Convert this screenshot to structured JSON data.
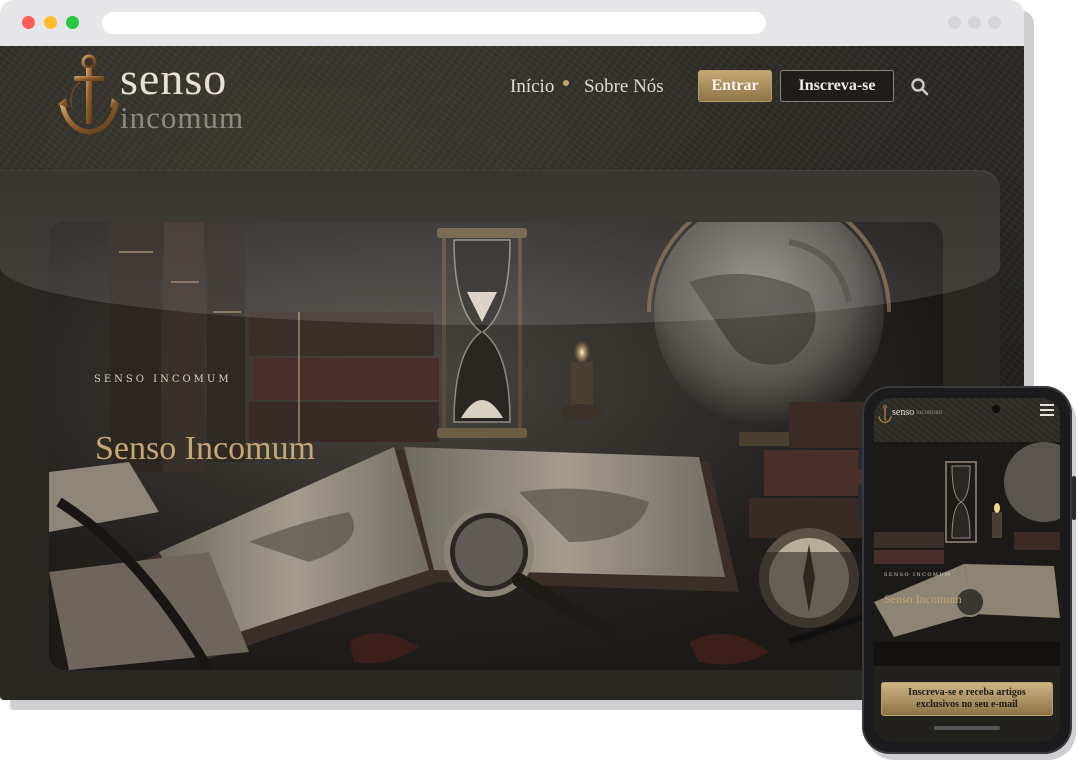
{
  "site": {
    "logo": {
      "word1": "senso",
      "word2": "incomum"
    },
    "nav": {
      "inicio": "Início",
      "sobre": "Sobre Nós",
      "entrar": "Entrar",
      "inscreva": "Inscreva-se"
    },
    "hero": {
      "eyebrow": "SENSO INCOMUM",
      "title": "Senso Incomum"
    }
  },
  "mobile": {
    "logo": {
      "word1": "senso",
      "word2": "incomum"
    },
    "hero": {
      "eyebrow": "SENSO INCOMUM",
      "title": "Senso Incomum"
    },
    "cta_line1": "Inscreva-se e receba artigos",
    "cta_line2": "exclusivos no seu e-mail"
  },
  "colors": {
    "accent_gold": "#c9a772",
    "background_dark": "#2a2823",
    "text_light": "#e3ddd2"
  },
  "icons": [
    "anchor-logo-icon",
    "search-icon",
    "hamburger-menu-icon"
  ]
}
